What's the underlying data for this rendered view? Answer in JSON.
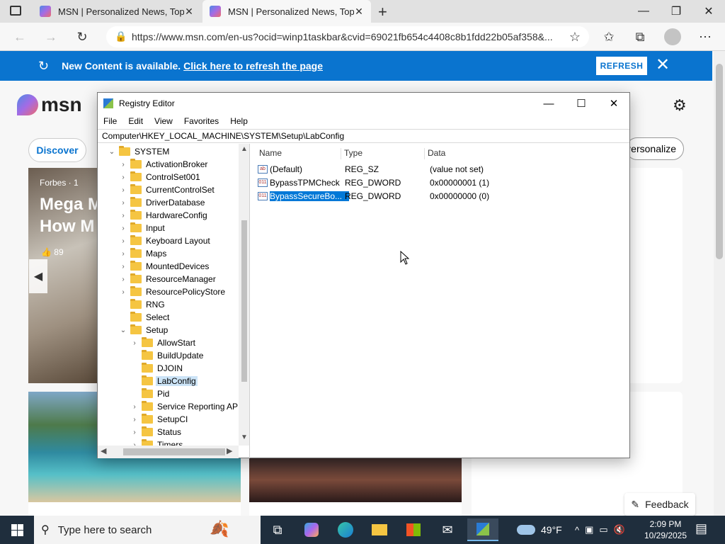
{
  "browser": {
    "tabs": [
      {
        "title": "MSN | Personalized News, Top H",
        "active": false
      },
      {
        "title": "MSN | Personalized News, Top H",
        "active": true
      }
    ],
    "new_tab_icon": "plus-icon",
    "url": "https://www.msn.com/en-us?ocid=winp1taskbar&cvid=69021fb654c4408c8b1fdd22b05af358&...",
    "window_controls": {
      "minimize": "—",
      "maximize": "❐",
      "close": "✕"
    }
  },
  "msn": {
    "banner": {
      "message": "New Content is available.",
      "link": "Click here to refresh the page",
      "refresh_button": "REFRESH",
      "close": "✕"
    },
    "logo_text": "msn",
    "discover_button": "Discover",
    "personalize_button": "Personalize",
    "featured": {
      "source": "Forbes · 1",
      "headline_line1": "Mega M",
      "headline_line2": "How M",
      "likes": "89"
    },
    "feedback_button": "Feedback"
  },
  "regedit": {
    "title": "Registry Editor",
    "menu": [
      "File",
      "Edit",
      "View",
      "Favorites",
      "Help"
    ],
    "address": "Computer\\HKEY_LOCAL_MACHINE\\SYSTEM\\Setup\\LabConfig",
    "tree": [
      {
        "label": "SYSTEM",
        "level": 0,
        "arrow": "⌄"
      },
      {
        "label": "ActivationBroker",
        "level": 1,
        "arrow": "›"
      },
      {
        "label": "ControlSet001",
        "level": 1,
        "arrow": "›"
      },
      {
        "label": "CurrentControlSet",
        "level": 1,
        "arrow": "›"
      },
      {
        "label": "DriverDatabase",
        "level": 1,
        "arrow": "›"
      },
      {
        "label": "HardwareConfig",
        "level": 1,
        "arrow": "›"
      },
      {
        "label": "Input",
        "level": 1,
        "arrow": "›"
      },
      {
        "label": "Keyboard Layout",
        "level": 1,
        "arrow": "›"
      },
      {
        "label": "Maps",
        "level": 1,
        "arrow": "›"
      },
      {
        "label": "MountedDevices",
        "level": 1,
        "arrow": "›"
      },
      {
        "label": "ResourceManager",
        "level": 1,
        "arrow": "›"
      },
      {
        "label": "ResourcePolicyStore",
        "level": 1,
        "arrow": "›"
      },
      {
        "label": "RNG",
        "level": 1,
        "arrow": ""
      },
      {
        "label": "Select",
        "level": 1,
        "arrow": ""
      },
      {
        "label": "Setup",
        "level": 1,
        "arrow": "⌄"
      },
      {
        "label": "AllowStart",
        "level": 2,
        "arrow": "›"
      },
      {
        "label": "BuildUpdate",
        "level": 2,
        "arrow": ""
      },
      {
        "label": "DJOIN",
        "level": 2,
        "arrow": ""
      },
      {
        "label": "LabConfig",
        "level": 2,
        "arrow": "",
        "selected": true
      },
      {
        "label": "Pid",
        "level": 2,
        "arrow": ""
      },
      {
        "label": "Service Reporting API",
        "level": 2,
        "arrow": "›"
      },
      {
        "label": "SetupCI",
        "level": 2,
        "arrow": "›"
      },
      {
        "label": "Status",
        "level": 2,
        "arrow": "›"
      },
      {
        "label": "Timers",
        "level": 2,
        "arrow": "›"
      }
    ],
    "columns": [
      "Name",
      "Type",
      "Data"
    ],
    "values": [
      {
        "name": "(Default)",
        "type": "REG_SZ",
        "data": "(value not set)",
        "icon": "ab",
        "selected": false
      },
      {
        "name": "BypassTPMCheck",
        "type": "REG_DWORD",
        "data": "0x00000001 (1)",
        "icon": "011",
        "selected": false
      },
      {
        "name": "BypassSecureBo...",
        "type": "REG_DWORD",
        "data": "0x00000000 (0)",
        "icon": "011",
        "selected": true
      }
    ]
  },
  "taskbar": {
    "search_placeholder": "Type here to search",
    "weather_temp": "49°F",
    "time": "2:09 PM",
    "date": "10/29/2025"
  }
}
